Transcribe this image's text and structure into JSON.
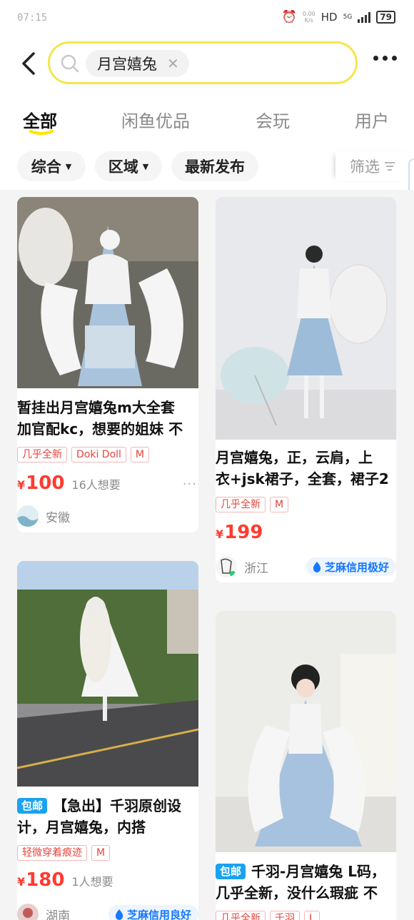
{
  "status_bar": {
    "time": "07:15",
    "speed_value": "0.00",
    "speed_unit": "K/s",
    "hd": "HD",
    "network": "5G",
    "battery": "79"
  },
  "search": {
    "query": "月宫嬉兔"
  },
  "tabs": [
    {
      "label": "全部",
      "active": true
    },
    {
      "label": "闲鱼优品",
      "active": false
    },
    {
      "label": "会玩",
      "active": false
    },
    {
      "label": "用户",
      "active": false
    }
  ],
  "filters": {
    "sort": "综合",
    "region": "区域",
    "latest": "最新发布",
    "screen": "筛选"
  },
  "colors": {
    "accent_yellow": "#FFE400",
    "price_red": "#FF3B30",
    "tag_red": "#E2453C",
    "credit_blue": "#1677FF",
    "baoyou_blue": "#1AA2F0"
  },
  "items": [
    {
      "title_lines": [
        "暂挂出月宫嬉兔m大全套",
        "加官配kc，想要的姐妹 不"
      ],
      "tags": [
        "几乎全新",
        "Doki Doll",
        "M"
      ],
      "price_symbol": "¥",
      "price": "100",
      "want": "16人想要",
      "region": "安徽",
      "credit": "",
      "baoyou": "",
      "more": "···"
    },
    {
      "title_lines": [
        "月宫嬉兔，正，云肩，上",
        "衣+jsk裙子，全套，裙子2"
      ],
      "tags": [
        "几乎全新",
        "M"
      ],
      "price_symbol": "¥",
      "price": "199",
      "want": "",
      "region": "浙江",
      "credit": "芝麻信用极好",
      "baoyou": ""
    },
    {
      "title_lines": [
        "【急出】千羽原创设",
        "计，月宫嬉兔，内搭"
      ],
      "tags": [
        "轻微穿着痕迹",
        "M"
      ],
      "price_symbol": "¥",
      "price": "180",
      "want": "1人想要",
      "region": "湖南",
      "credit": "芝麻信用良好",
      "baoyou": "包邮"
    },
    {
      "title_lines": [
        "千羽-月宫嬉兔 L码，",
        "几乎全新，没什么瑕疵 不"
      ],
      "tags": [
        "几乎全新",
        "千羽",
        "L"
      ],
      "price_symbol": "",
      "price": "",
      "want": "",
      "region": "",
      "credit": "",
      "baoyou": "包邮"
    }
  ]
}
